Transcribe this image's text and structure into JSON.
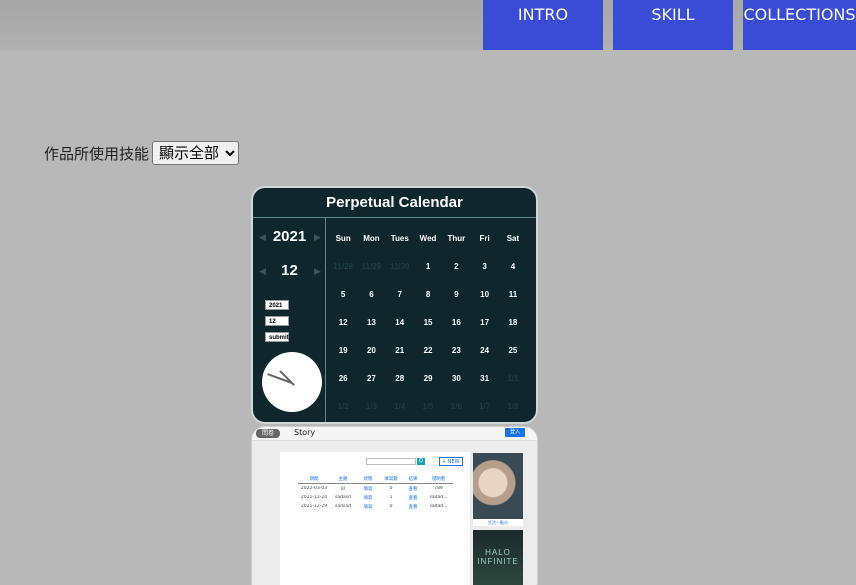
{
  "nav": {
    "items": [
      "INTRO",
      "SKILL",
      "COLLECTIONS"
    ]
  },
  "filter": {
    "label": "作品所使用技能",
    "selected": "顯示全部"
  },
  "calendar": {
    "title": "Perpetual Calendar",
    "year": "2021",
    "month": "12",
    "inputs": {
      "year": "2021",
      "month": "12",
      "submit": "submit"
    },
    "weekdays": [
      "Sun",
      "Mon",
      "Tues",
      "Wed",
      "Thur",
      "Fri",
      "Sat"
    ],
    "weeks": [
      [
        "11/28",
        "11/29",
        "11/30",
        "1",
        "2",
        "3",
        "4"
      ],
      [
        "5",
        "6",
        "7",
        "8",
        "9",
        "10",
        "11"
      ],
      [
        "12",
        "13",
        "14",
        "15",
        "16",
        "17",
        "18"
      ],
      [
        "19",
        "20",
        "21",
        "22",
        "23",
        "24",
        "25"
      ],
      [
        "26",
        "27",
        "28",
        "29",
        "30",
        "31",
        "1/1"
      ],
      [
        "1/2",
        "1/3",
        "1/4",
        "1/5",
        "1/6",
        "1/7",
        "1/8"
      ]
    ]
  },
  "story": {
    "tag": "問卷",
    "name": "Story",
    "login": "登入",
    "new_button": "+ NEW",
    "search_button": "Q",
    "table": {
      "headers": [
        "期間",
        "主題",
        "狀態",
        "填寫數",
        "結果",
        "證明者"
      ],
      "rows": [
        [
          "2022-03-03",
          "jjj",
          "填寫",
          "0",
          "查看",
          "789"
        ],
        [
          "2021-12-24",
          "sadasd",
          "填寫",
          "1",
          "查看",
          "sadad..."
        ],
        [
          "2021-12-29",
          "sadsad",
          "填寫",
          "0",
          "查看",
          "sadad..."
        ]
      ]
    },
    "thumb1_caption": "生活一點分",
    "thumb2_text": "HALO INFINITE"
  }
}
